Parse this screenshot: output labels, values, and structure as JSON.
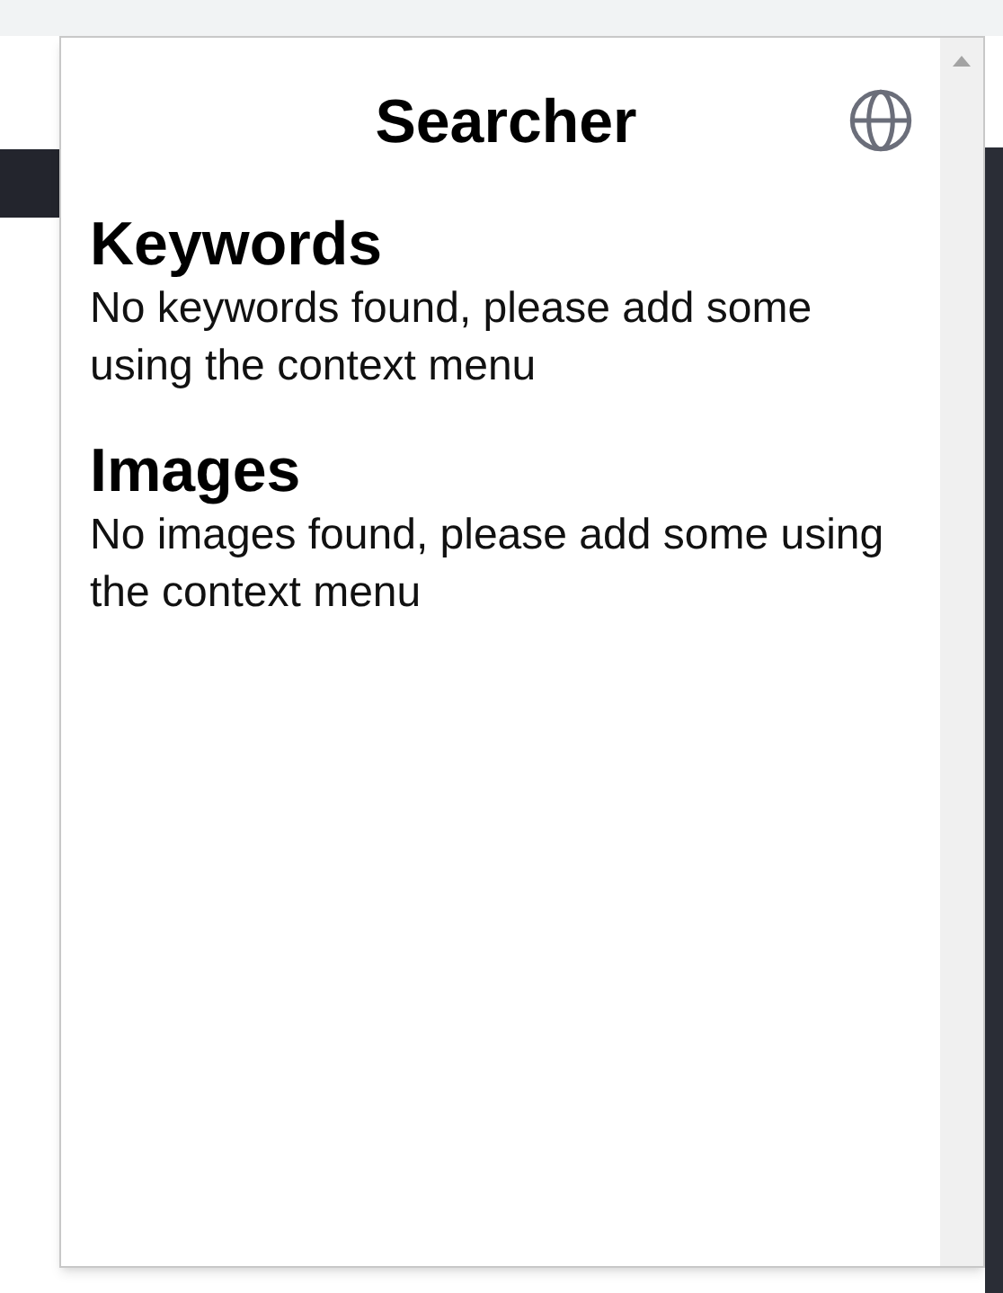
{
  "popup": {
    "title": "Searcher"
  },
  "sections": [
    {
      "heading": "Keywords",
      "message": "No keywords found, please add some using the context menu"
    },
    {
      "heading": "Images",
      "message": "No images found, please add some using the context menu"
    }
  ]
}
